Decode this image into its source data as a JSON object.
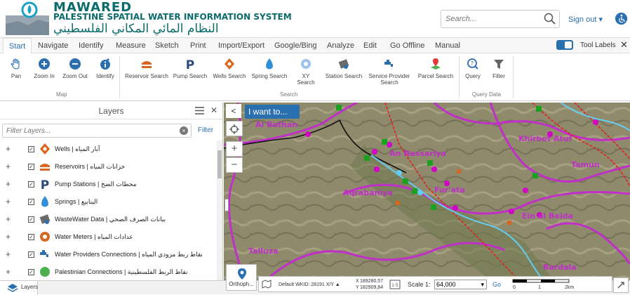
{
  "header": {
    "title_en": "MAWARED",
    "subtitle_en": "PALESTINE SPATIAL WATER INFORMATION SYSTEM",
    "title_ar": "النظام المائي المكاني الفلسطيني",
    "search_placeholder": "Search...",
    "signout": "Sign out",
    "signout_caret": "▾"
  },
  "menu": {
    "items": [
      "Start",
      "Navigate",
      "Identify",
      "Measure",
      "Sketch",
      "Print",
      "Import/Export",
      "Google/Bing",
      "Analyze",
      "Edit",
      "Go Offline",
      "Manual"
    ],
    "tool_labels": "Tool Labels",
    "close": "✕"
  },
  "ribbon": {
    "map_tools": [
      "Pan",
      "Zoom In",
      "Zoom Out",
      "Identify"
    ],
    "map_label": "Map",
    "search_tools": [
      "Reservoir Search",
      "Pump Search",
      "Wells Search",
      "Spring Search",
      "XY Search",
      "Station Search",
      "Service Provider Search",
      "Parcel Search"
    ],
    "search_label": "Search",
    "query_tools": [
      "Query",
      "Filter"
    ],
    "query_label": "Query Data"
  },
  "layers_panel": {
    "title": "Layers",
    "filter_placeholder": "Filter Layers...",
    "filter_button": "Filter",
    "close": "✕",
    "layers": [
      {
        "name": "Wells | آبار المياه",
        "icon": "well-icon"
      },
      {
        "name": "Reservoirs | خزانات المياه",
        "icon": "reservoir-icon"
      },
      {
        "name": "Pump Stations | محطات الضخ",
        "icon": "pump-icon"
      },
      {
        "name": "Springs | الينابيع",
        "icon": "spring-icon"
      },
      {
        "name": "WasteWater Data | بيانات الصرف الصحي",
        "icon": "wastewater-icon"
      },
      {
        "name": "Water Meters | عدادات المياه",
        "icon": "meter-icon"
      },
      {
        "name": "Water Providers Connections | نقاط ربط مزودي المياه",
        "icon": "tap-icon"
      },
      {
        "name": "Palestinian Connections | نقاط الربط الفلسطينية",
        "icon": "connection-icon"
      }
    ]
  },
  "bottom": {
    "layers_tab": "Layers"
  },
  "map": {
    "i_want_to": "I want to...",
    "basemap_label": "Orthoph...",
    "projection": "Default WKID: 28191 X/Y ▲",
    "x_label": "X",
    "x_value": "189280,57",
    "y_label": "Y",
    "y_value": "182909,84",
    "scale_label": "Scale 1:",
    "scale_value": "64,000",
    "go": "Go",
    "scalebar": [
      "0",
      "1",
      "2km"
    ],
    "place_labels": [
      {
        "text": "Al Bathan"
      },
      {
        "text": "An Nassariya"
      },
      {
        "text": "Aqrabaniya"
      },
      {
        "text": "Fur'ata"
      },
      {
        "text": "Khirbet Atuf"
      },
      {
        "text": "Tamun"
      },
      {
        "text": "Talluza"
      },
      {
        "text": "Ein al Beida"
      },
      {
        "text": "Bardala"
      }
    ],
    "colors": {
      "boundary": "#c030c8",
      "road": "#e02020",
      "river": "#66ccee"
    }
  }
}
